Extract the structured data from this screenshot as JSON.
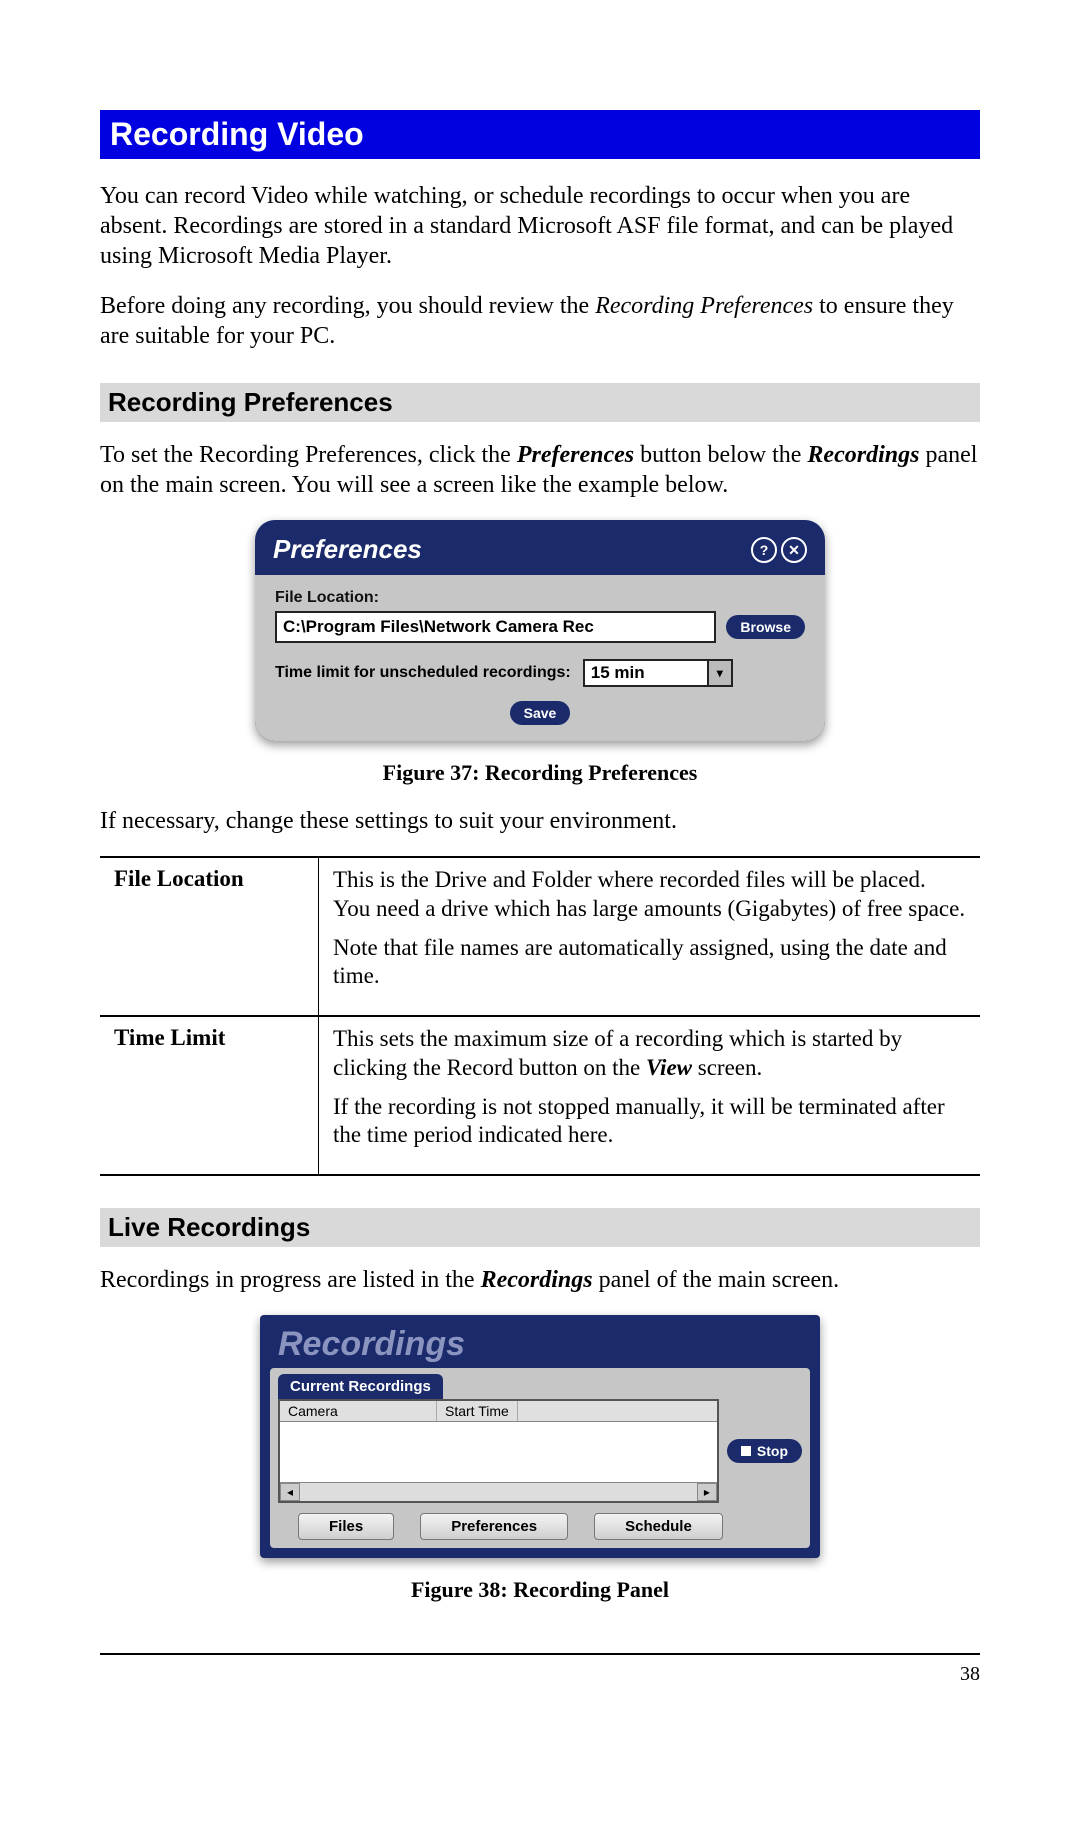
{
  "heading": "Recording Video",
  "intro1_a": "You can record Video while watching, or schedule recordings to occur when you are absent. Recordings are stored in a standard Microsoft ASF file format, and can be played using Microsoft Media Player.",
  "intro2_a": "Before doing any recording, you should review the ",
  "intro2_b": "Recording Preferences",
  "intro2_c": " to ensure they are suitable for your PC.",
  "sub1": "Recording Preferences",
  "sub1_p_a": "To set the Recording Preferences, click the ",
  "sub1_p_b": "Preferences",
  "sub1_p_c": " button below the ",
  "sub1_p_d": "Recordings",
  "sub1_p_e": " panel on the main screen. You will see a screen like the example below.",
  "pref_dialog": {
    "title": "Preferences",
    "help_icon": "?",
    "close_icon": "✕",
    "file_location_label": "File Location:",
    "file_location_value": "C:\\Program Files\\Network Camera Rec",
    "browse": "Browse",
    "time_limit_label": "Time limit for unscheduled recordings:",
    "time_limit_value": "15 min",
    "save": "Save"
  },
  "fig37_caption": "Figure 37: Recording Preferences",
  "after_fig37": "If necessary, change these settings to suit your environment.",
  "table": {
    "r1_label": "File Location",
    "r1_p1": "This is the Drive and Folder where recorded files will be placed. You need a drive which has large amounts (Gigabytes) of free space.",
    "r1_p2": "Note that file names are automatically assigned, using the date and time.",
    "r2_label": "Time Limit",
    "r2_p1_a": "This sets the maximum size of a recording which is started by clicking the Record button on the ",
    "r2_p1_b": "View",
    "r2_p1_c": " screen.",
    "r2_p2": "If the recording is not stopped manually, it will be terminated after the time period indicated here."
  },
  "sub2": "Live Recordings",
  "sub2_p_a": "Recordings in progress are listed in the ",
  "sub2_p_b": "Recordings",
  "sub2_p_c": " panel of the main screen.",
  "rec_panel": {
    "title": "Recordings",
    "tab": "Current Recordings",
    "col1": "Camera",
    "col2": "Start Time",
    "stop": "Stop",
    "files": "Files",
    "preferences": "Preferences",
    "schedule": "Schedule",
    "scroll_left": "◂",
    "scroll_right": "▸"
  },
  "fig38_caption": "Figure 38: Recording Panel",
  "page_number": "38"
}
